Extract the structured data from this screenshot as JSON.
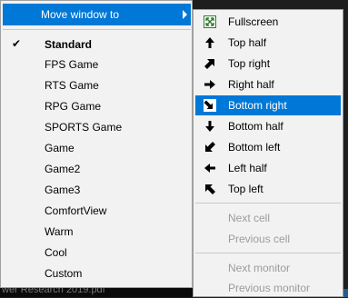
{
  "background": {
    "text": "wer Research 2019.pdf"
  },
  "menu": {
    "submenu_label": "Move window to",
    "items": [
      {
        "label": "Standard",
        "checked": true
      },
      {
        "label": "FPS Game"
      },
      {
        "label": "RTS Game"
      },
      {
        "label": "RPG Game"
      },
      {
        "label": "SPORTS Game"
      },
      {
        "label": "Game"
      },
      {
        "label": "Game2"
      },
      {
        "label": "Game3"
      },
      {
        "label": "ComfortView"
      },
      {
        "label": "Warm"
      },
      {
        "label": "Cool"
      },
      {
        "label": "Custom"
      }
    ],
    "check_glyph": "✔"
  },
  "submenu": {
    "items": [
      {
        "label": "Fullscreen",
        "icon": "fullscreen-icon"
      },
      {
        "label": "Top half",
        "icon": "arrow-up-icon"
      },
      {
        "label": "Top right",
        "icon": "arrow-up-right-icon"
      },
      {
        "label": "Right half",
        "icon": "arrow-right-icon"
      },
      {
        "label": "Bottom right",
        "icon": "arrow-down-right-icon",
        "highlighted": true
      },
      {
        "label": "Bottom half",
        "icon": "arrow-down-icon"
      },
      {
        "label": "Bottom left",
        "icon": "arrow-down-left-icon"
      },
      {
        "label": "Left half",
        "icon": "arrow-left-icon"
      },
      {
        "label": "Top left",
        "icon": "arrow-up-left-icon"
      },
      {
        "label": "Next cell",
        "disabled": true
      },
      {
        "label": "Previous cell",
        "disabled": true
      },
      {
        "label": "Next monitor",
        "disabled": true
      },
      {
        "label": "Previous monitor",
        "disabled": true
      }
    ]
  },
  "colors": {
    "highlight": "#0078d7",
    "menu_bg": "#f2f2f2",
    "disabled_text": "#9c9c9c"
  }
}
